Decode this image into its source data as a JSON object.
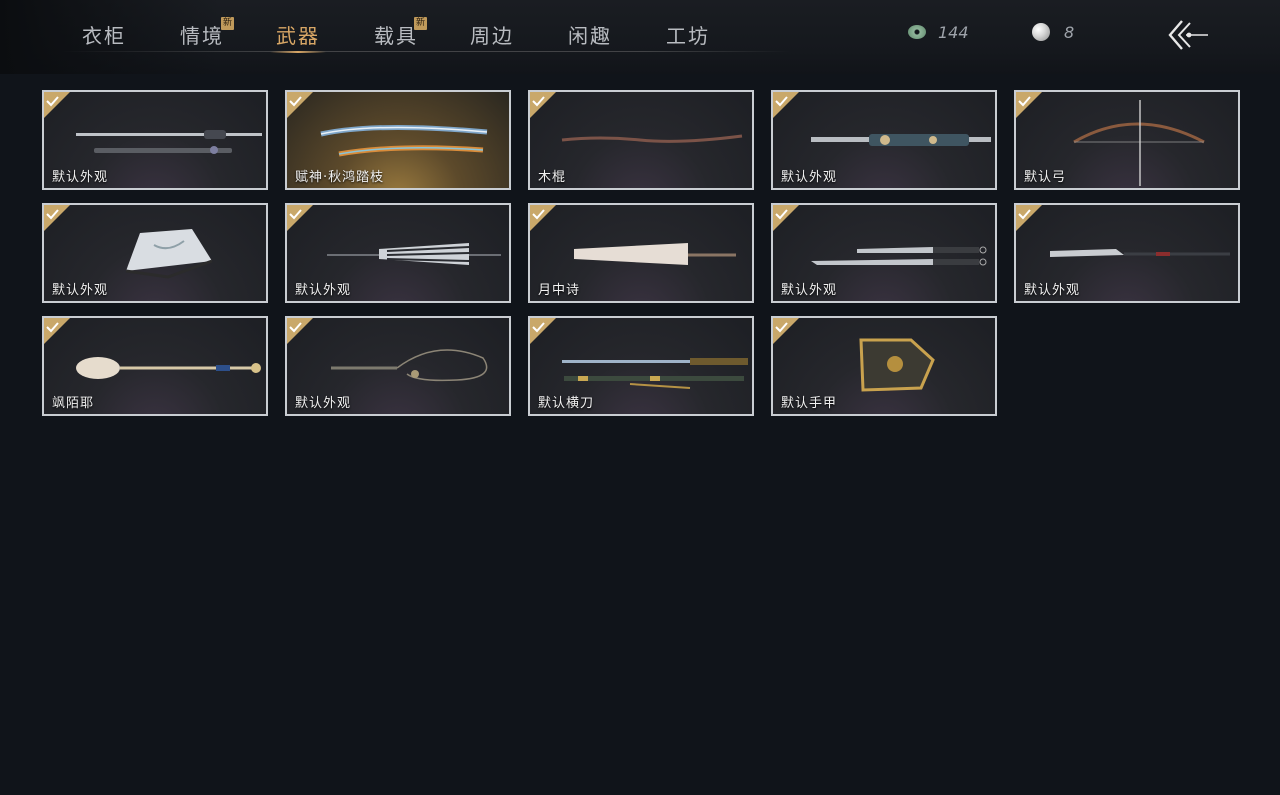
{
  "tabs": [
    {
      "label": "衣柜",
      "active": false,
      "new": false
    },
    {
      "label": "情境",
      "active": false,
      "new": true
    },
    {
      "label": "武器",
      "active": true,
      "new": false
    },
    {
      "label": "载具",
      "active": false,
      "new": true
    },
    {
      "label": "周边",
      "active": false,
      "new": false
    },
    {
      "label": "闲趣",
      "active": false,
      "new": false
    },
    {
      "label": "工坊",
      "active": false,
      "new": false
    }
  ],
  "new_badge": "新",
  "currency": {
    "jade_coins": "144",
    "pearls": "8"
  },
  "colors": {
    "accent": "#d9a766",
    "check_gold": "#c9a86a",
    "background": "#10141a"
  },
  "weapons": [
    {
      "name": "默认外观",
      "icon": "sword-icon",
      "owned": true
    },
    {
      "name": "赋神·秋鸿踏枝",
      "icon": "ornate-spear-icon",
      "owned": true
    },
    {
      "name": "木棍",
      "icon": "wooden-staff-icon",
      "owned": true
    },
    {
      "name": "默认外观",
      "icon": "twin-blade-icon",
      "owned": true
    },
    {
      "name": "默认弓",
      "icon": "bow-icon",
      "owned": true
    },
    {
      "name": "默认外观",
      "icon": "fan-icon",
      "owned": true
    },
    {
      "name": "默认外观",
      "icon": "closed-umbrella-icon",
      "owned": true
    },
    {
      "name": "月中诗",
      "icon": "parasol-icon",
      "owned": true
    },
    {
      "name": "默认外观",
      "icon": "dual-sabre-icon",
      "owned": true
    },
    {
      "name": "默认外观",
      "icon": "glaive-icon",
      "owned": true
    },
    {
      "name": "飒陌耶",
      "icon": "mirror-staff-icon",
      "owned": true
    },
    {
      "name": "默认外观",
      "icon": "rope-dart-icon",
      "owned": true
    },
    {
      "name": "默认横刀",
      "icon": "hengdao-icon",
      "owned": true
    },
    {
      "name": "默认手甲",
      "icon": "gauntlet-icon",
      "owned": true
    }
  ]
}
